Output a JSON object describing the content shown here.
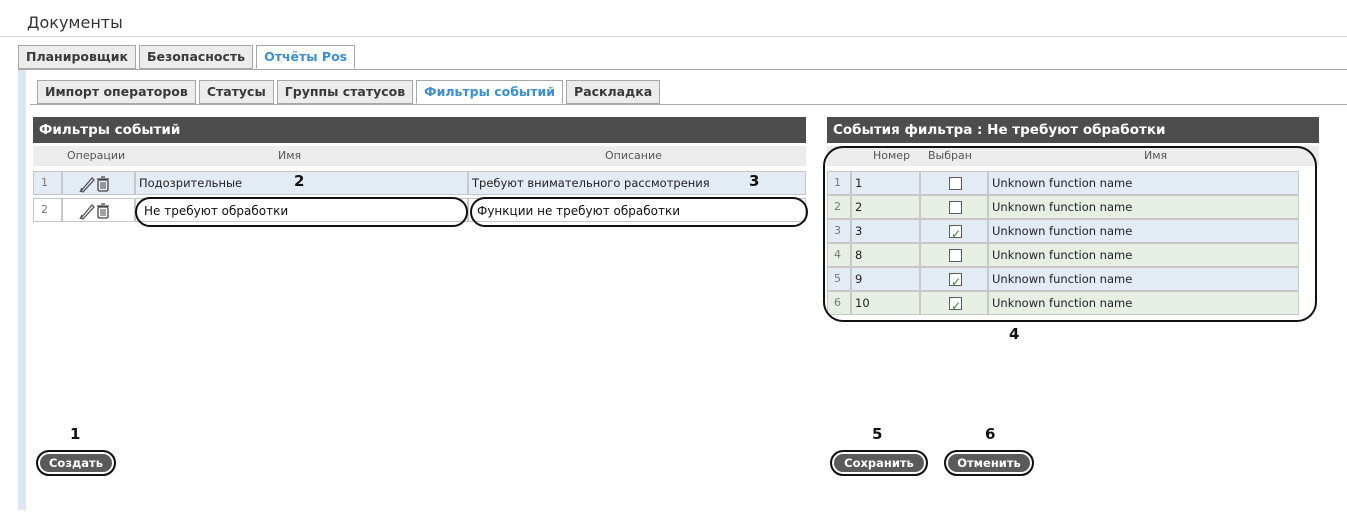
{
  "docs": {
    "title": "Документы"
  },
  "tabs_top": [
    "Планировщик",
    "Безопасность",
    "Отчёты Pos"
  ],
  "tabs_sub": [
    "Импорт операторов",
    "Статусы",
    "Группы статусов",
    "Фильтры событий",
    "Раскладка"
  ],
  "filters": {
    "title": "Фильтры событий",
    "columns": [
      "Операции",
      "Имя",
      "Описание"
    ],
    "rows": [
      {
        "num": "1",
        "name": "Подозрительные",
        "description": "Требуют внимательного рассмотрения"
      },
      {
        "num": "2",
        "name": "Не требуют обработки",
        "description": "Функции не требуют обработки"
      }
    ]
  },
  "events": {
    "title": "События фильтра : Не требуют обработки",
    "columns": [
      "Номер",
      "Выбран",
      "Имя"
    ],
    "rows": [
      {
        "idx": "1",
        "number": "1",
        "selected": false,
        "name": "Unknown function name"
      },
      {
        "idx": "2",
        "number": "2",
        "selected": false,
        "name": "Unknown function name"
      },
      {
        "idx": "3",
        "number": "3",
        "selected": true,
        "name": "Unknown function name"
      },
      {
        "idx": "4",
        "number": "8",
        "selected": false,
        "name": "Unknown function name"
      },
      {
        "idx": "5",
        "number": "9",
        "selected": true,
        "name": "Unknown function name"
      },
      {
        "idx": "6",
        "number": "10",
        "selected": true,
        "name": "Unknown function name"
      }
    ]
  },
  "buttons": {
    "create": "Создать",
    "save": "Сохранить",
    "cancel": "Отменить"
  },
  "annotations": {
    "n1": "1",
    "n2": "2",
    "n3": "3",
    "n4": "4",
    "n5": "5",
    "n6": "6"
  },
  "colors": {
    "active_tab": "#3d8fd1",
    "header_bg": "#4d4d4d",
    "row_blue": "#e3ebf4",
    "row_green": "#e7efe4"
  },
  "icons": [
    "pencil-icon",
    "trash-icon"
  ]
}
